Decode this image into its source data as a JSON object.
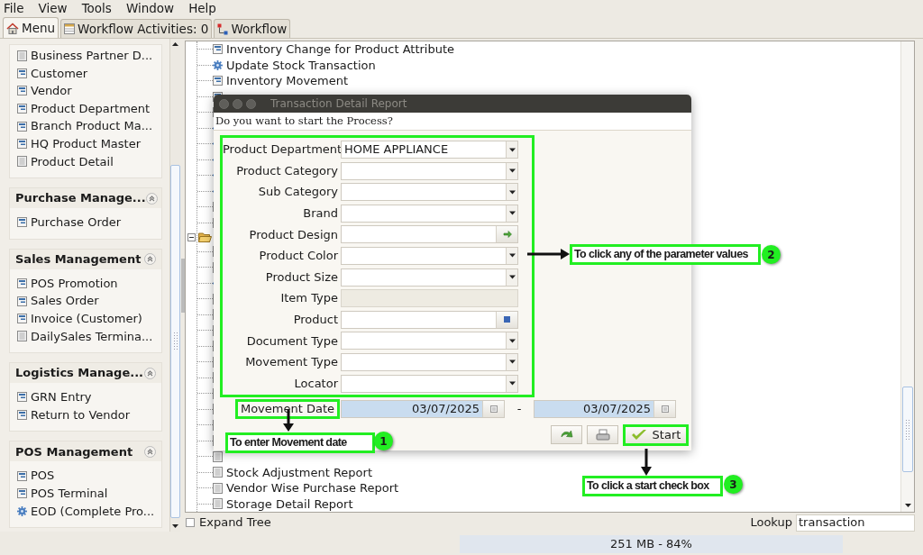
{
  "menu_bar": [
    {
      "label": "File"
    },
    {
      "label": "View"
    },
    {
      "label": "Tools"
    },
    {
      "label": "Window"
    },
    {
      "label": "Help"
    }
  ],
  "tabs": [
    {
      "label": "Menu",
      "kind": "home",
      "selected": true
    },
    {
      "label": "Workflow Activities: 0",
      "kind": "table",
      "selected": false
    },
    {
      "label": "Workflow",
      "kind": "workflow",
      "selected": false
    }
  ],
  "sidebar": {
    "sections": [
      {
        "items": [
          {
            "label": "Business Partner D...",
            "kind": "report"
          },
          {
            "label": "Customer",
            "kind": "window"
          },
          {
            "label": "Vendor",
            "kind": "window"
          },
          {
            "label": "Product Department",
            "kind": "window"
          },
          {
            "label": "Branch Product Ma...",
            "kind": "window"
          },
          {
            "label": "HQ Product Master",
            "kind": "window"
          },
          {
            "label": "Product Detail",
            "kind": "report"
          }
        ]
      },
      {
        "title": "Purchase Manage...",
        "items": [
          {
            "label": "Purchase Order",
            "kind": "window"
          }
        ]
      },
      {
        "title": "Sales Management",
        "items": [
          {
            "label": "POS Promotion",
            "kind": "window"
          },
          {
            "label": "Sales Order",
            "kind": "window"
          },
          {
            "label": "Invoice (Customer)",
            "kind": "window"
          },
          {
            "label": "DailySales Termina...",
            "kind": "report"
          }
        ]
      },
      {
        "title": "Logistics Manage...",
        "items": [
          {
            "label": "GRN Entry",
            "kind": "window"
          },
          {
            "label": "Return to Vendor",
            "kind": "window"
          }
        ]
      },
      {
        "title": "POS Management",
        "items": [
          {
            "label": "POS",
            "kind": "window"
          },
          {
            "label": "POS Terminal",
            "kind": "window"
          },
          {
            "label": "EOD (Complete Pro...",
            "kind": "process"
          }
        ]
      }
    ]
  },
  "tree": [
    {
      "children": [
        {
          "label": "Inventory Change for Product Attribute",
          "kind": "window"
        },
        {
          "label": "Update Stock Transaction",
          "kind": "process"
        },
        {
          "label": "Inventory Movement",
          "kind": "window"
        },
        {
          "kind": "window"
        },
        {
          "kind": "window"
        },
        {
          "kind": "process"
        },
        {
          "kind": "process"
        },
        {
          "kind": "process"
        },
        {
          "kind": "process"
        },
        {
          "kind": "process"
        },
        {
          "kind": "window"
        },
        {
          "kind": "window"
        }
      ]
    },
    {
      "kind": "folder",
      "expanded": true,
      "children": [
        {
          "kind": "report"
        },
        {
          "kind": "report"
        },
        {
          "kind": "process"
        },
        {
          "kind": "report"
        },
        {
          "kind": "report"
        },
        {
          "kind": "report"
        },
        {
          "kind": "report"
        },
        {
          "kind": "report"
        },
        {
          "kind": "report"
        },
        {
          "kind": "report"
        },
        {
          "kind": "report"
        },
        {
          "kind": "report"
        },
        {
          "kind": "report"
        },
        {
          "kind": "report"
        },
        {
          "label": "Stock Adjustment Report",
          "kind": "report"
        },
        {
          "label": "Vendor Wise Purchase Report",
          "kind": "report"
        },
        {
          "label": "Storage Detail Report",
          "kind": "report"
        }
      ]
    }
  ],
  "expand_tree": {
    "label": "Expand Tree",
    "checked": false
  },
  "lookup": {
    "label": "Lookup",
    "value": "transaction"
  },
  "status_bar": {
    "memory": "251 MB - 84%"
  },
  "dialog": {
    "title": "Transaction Detail Report",
    "question": "Do you want to start the Process?",
    "parameters": [
      {
        "label": "Product Department",
        "kind": "combo",
        "value": "HOME APPLIANCE"
      },
      {
        "label": "Product Category",
        "kind": "combo"
      },
      {
        "label": "Sub Category",
        "kind": "combo"
      },
      {
        "label": "Brand",
        "kind": "combo"
      },
      {
        "label": "Product Design",
        "kind": "assign"
      },
      {
        "label": "Product Color",
        "kind": "combo"
      },
      {
        "label": "Product Size",
        "kind": "combo"
      },
      {
        "label": "Item Type",
        "kind": "readonly"
      },
      {
        "label": "Product",
        "kind": "search"
      },
      {
        "label": "Document Type",
        "kind": "combo"
      },
      {
        "label": "Movement Type",
        "kind": "combo"
      },
      {
        "label": "Locator",
        "kind": "combo"
      }
    ],
    "date_range": {
      "label": "Movement Date",
      "from": "03/07/2025",
      "separator": "-",
      "to": "03/07/2025"
    },
    "buttons": [
      {
        "kind": "refresh"
      },
      {
        "kind": "print"
      },
      {
        "kind": "start",
        "label": "Start"
      }
    ]
  },
  "annotations": [
    {
      "number": "1",
      "text": "To enter Movement date"
    },
    {
      "number": "2",
      "text": "To click any of the parameter values"
    },
    {
      "number": "3",
      "text": "To click a start check box"
    }
  ]
}
